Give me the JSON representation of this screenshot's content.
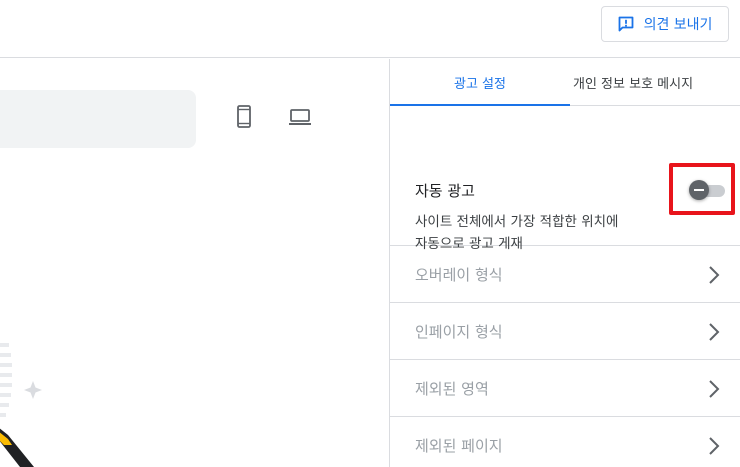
{
  "header": {
    "feedback_button": {
      "label": "의견 보내기",
      "icon": "feedback-icon"
    }
  },
  "preview": {
    "device_buttons": [
      {
        "name": "phone",
        "icon": "smartphone-icon"
      },
      {
        "name": "laptop",
        "icon": "laptop-icon"
      }
    ]
  },
  "panel": {
    "tabs": [
      {
        "label": "광고 설정",
        "active": true
      },
      {
        "label": "개인 정보 보호 메시지",
        "active": false
      }
    ],
    "auto_ads": {
      "title": "자동 광고",
      "description_line1": "사이트 전체에서 가장 적합한 위치에",
      "description_line2": "자동으로 광고 게재",
      "toggle_on": false,
      "highlight_color": "#e8141b"
    },
    "sections": [
      {
        "label": "오버레이 형식"
      },
      {
        "label": "인페이지 형식"
      },
      {
        "label": "제외된 영역"
      },
      {
        "label": "제외된 페이지"
      }
    ]
  },
  "colors": {
    "accent": "#1a73e8",
    "divider": "#dadce0",
    "muted_text": "#9aa0a6"
  }
}
